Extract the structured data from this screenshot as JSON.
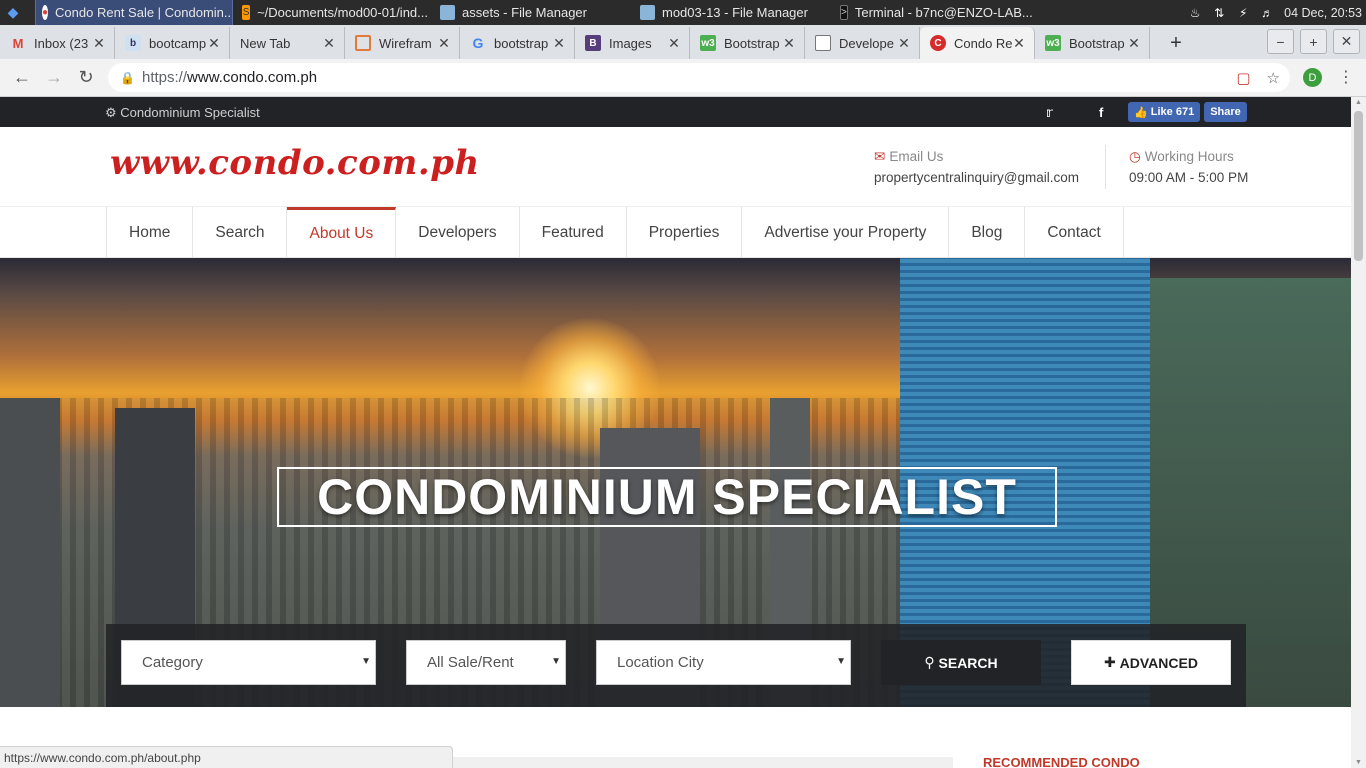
{
  "taskbar": {
    "tasks": [
      {
        "label": "Condo Rent Sale | Condomin...",
        "active": true
      },
      {
        "label": "~/Documents/mod00-01/ind..."
      },
      {
        "label": "assets - File Manager"
      },
      {
        "label": "mod03-13 - File Manager"
      },
      {
        "label": "Terminal - b7nc@ENZO-LAB..."
      }
    ],
    "clock": "04 Dec, 20:53"
  },
  "browser": {
    "tabs": [
      {
        "label": "Inbox (23"
      },
      {
        "label": "bootcamp"
      },
      {
        "label": "New Tab"
      },
      {
        "label": "Wirefram"
      },
      {
        "label": "bootstrap"
      },
      {
        "label": "Images"
      },
      {
        "label": "Bootstrap"
      },
      {
        "label": "Develope"
      },
      {
        "label": "Condo Re",
        "active": true
      },
      {
        "label": "Bootstrap"
      }
    ],
    "url_scheme": "https://",
    "url_host": "www.condo.com.ph",
    "profile_initial": "D",
    "status_url": "https://www.condo.com.ph/about.php"
  },
  "site": {
    "tagline": "Condominium Specialist",
    "fb_like": "Like 671",
    "fb_share": "Share",
    "logo": "www.condo.com.ph",
    "email_label": "Email Us",
    "email_value": "propertycentralinquiry@gmail.com",
    "hours_label": "Working Hours",
    "hours_value": "09:00 AM - 5:00 PM",
    "nav": [
      "Home",
      "Search",
      "About Us",
      "Developers",
      "Featured",
      "Properties",
      "Advertise your Property",
      "Blog",
      "Contact"
    ],
    "active_nav": "About Us",
    "hero_title": "CONDOMINIUM SPECIALIST",
    "search": {
      "category": "Category",
      "sale_rent": "All Sale/Rent",
      "location": "Location City",
      "search_btn": "SEARCH",
      "advanced_btn": "ADVANCED"
    },
    "recommended": "RECOMMENDED CONDO"
  },
  "colors": {
    "accent": "#c0392b",
    "dark": "#222327",
    "logo": "#cc1f1f"
  }
}
